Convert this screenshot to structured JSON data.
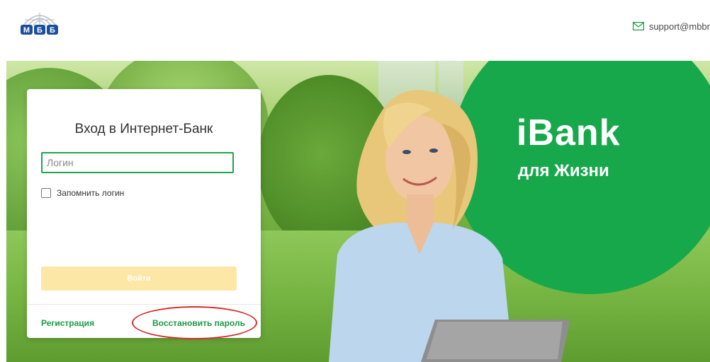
{
  "header": {
    "logo_text": "МББ",
    "support_email": "support@mbbr"
  },
  "hero": {
    "brand": "iBank",
    "tagline": "для Жизни"
  },
  "login": {
    "title": "Вход в Интернет-Банк",
    "login_placeholder": "Логин",
    "login_value": "",
    "remember_label": "Запомнить логин",
    "remember_checked": false,
    "submit_label": "Войти",
    "register_link": "Регистрация",
    "restore_link": "Восстановить пароль"
  },
  "colors": {
    "brand_green": "#16a84a",
    "link_green": "#1a9a44",
    "input_border": "#1ea64c",
    "submit_disabled": "#fde7a7",
    "highlight": "#d62b2b"
  },
  "icons": {
    "logo": "mbb-globe-logo",
    "email": "envelope-icon"
  }
}
